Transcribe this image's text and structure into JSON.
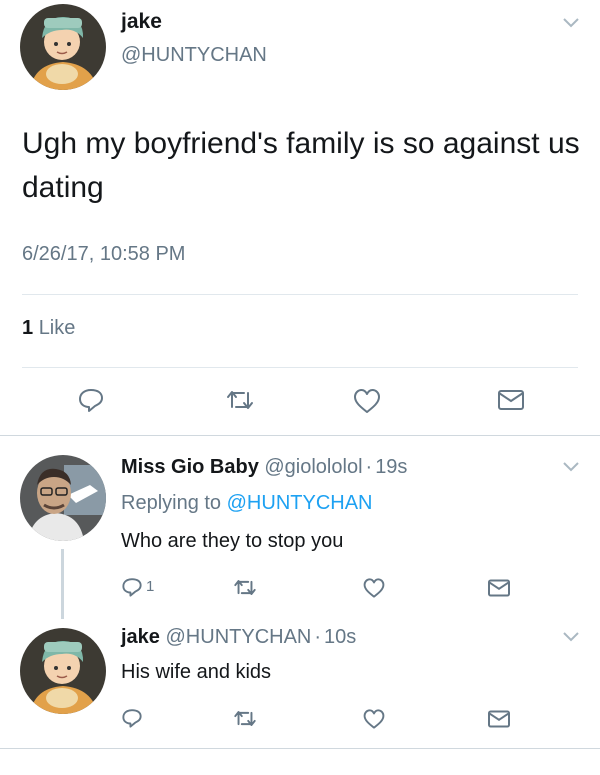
{
  "main_tweet": {
    "author_name": "jake",
    "author_handle": "@HUNTYCHAN",
    "text": "Ugh my boyfriend's family is so against us dating",
    "timestamp": "6/26/17, 10:58 PM",
    "likes_count": "1",
    "likes_label": "Like"
  },
  "reply_1": {
    "author_name": "Miss Gio Baby",
    "author_handle": "@giolololol",
    "separator": "·",
    "time": "19s",
    "replying_prefix": "Replying to",
    "replying_handle": "@HUNTYCHAN",
    "text": "Who are they to stop you",
    "reply_count": "1"
  },
  "reply_2": {
    "author_name": "jake",
    "author_handle": "@HUNTYCHAN",
    "separator": "·",
    "time": "10s",
    "text": "His wife and kids"
  },
  "icons": {
    "reply": "reply-icon",
    "retweet": "retweet-icon",
    "like": "heart-icon",
    "dm": "envelope-icon",
    "more": "chevron-down-icon"
  },
  "colors": {
    "text": "#14171a",
    "secondary": "#657786",
    "link": "#1da1f2",
    "divider": "#e1e8ed"
  }
}
